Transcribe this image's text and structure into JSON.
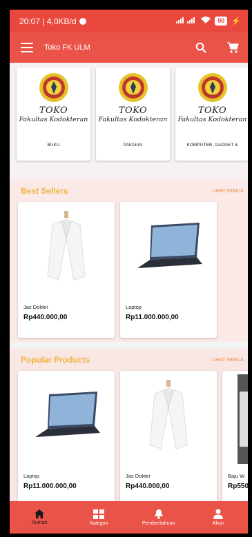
{
  "status_bar": {
    "time_speed": "20:07 | 4,0KB/d",
    "battery": "90"
  },
  "app_bar": {
    "title": "Toko FK ULM",
    "icons": [
      "menu-icon",
      "search-icon",
      "cart-icon"
    ]
  },
  "categories": [
    {
      "toko": "TOKO",
      "faculty": "Fakultas Kodokteran",
      "name": "BUKU"
    },
    {
      "toko": "TOKO",
      "faculty": "Fakultas Kodokteran",
      "name": "PAKAIAN"
    },
    {
      "toko": "TOKO",
      "faculty": "Fakultas Kodokteran",
      "name": "KOMPUTER, GADGET &"
    }
  ],
  "best_sellers": {
    "title": "Best Sellers",
    "see_all": "LIHAT SEMUA",
    "products": [
      {
        "name": "Jas Dokter",
        "price": "Rp440.000,00",
        "image": "white-coat"
      },
      {
        "name": "Laptop",
        "price": "Rp11.000.000,00",
        "image": "laptop"
      }
    ]
  },
  "popular_products": {
    "title": "Popular Products",
    "see_all": "LIHAT SEMUA",
    "products": [
      {
        "name": "Laptop",
        "price": "Rp11.000.000,00",
        "image": "laptop"
      },
      {
        "name": "Jas Dokter",
        "price": "Rp440.000,00",
        "image": "white-coat"
      },
      {
        "name": "Baju W",
        "price": "Rp550",
        "image": "clothing"
      }
    ]
  },
  "bottom_nav": [
    {
      "label": "Rumah",
      "icon": "home-icon",
      "active": true
    },
    {
      "label": "Kategori",
      "icon": "category-icon",
      "active": false
    },
    {
      "label": "Pemberitahuan",
      "icon": "bell-icon",
      "active": false
    },
    {
      "label": "Akun",
      "icon": "account-icon",
      "active": false
    }
  ],
  "colors": {
    "primary": "#ea5448",
    "section_title": "#f0b33f",
    "see_all": "#ef8a3e"
  }
}
